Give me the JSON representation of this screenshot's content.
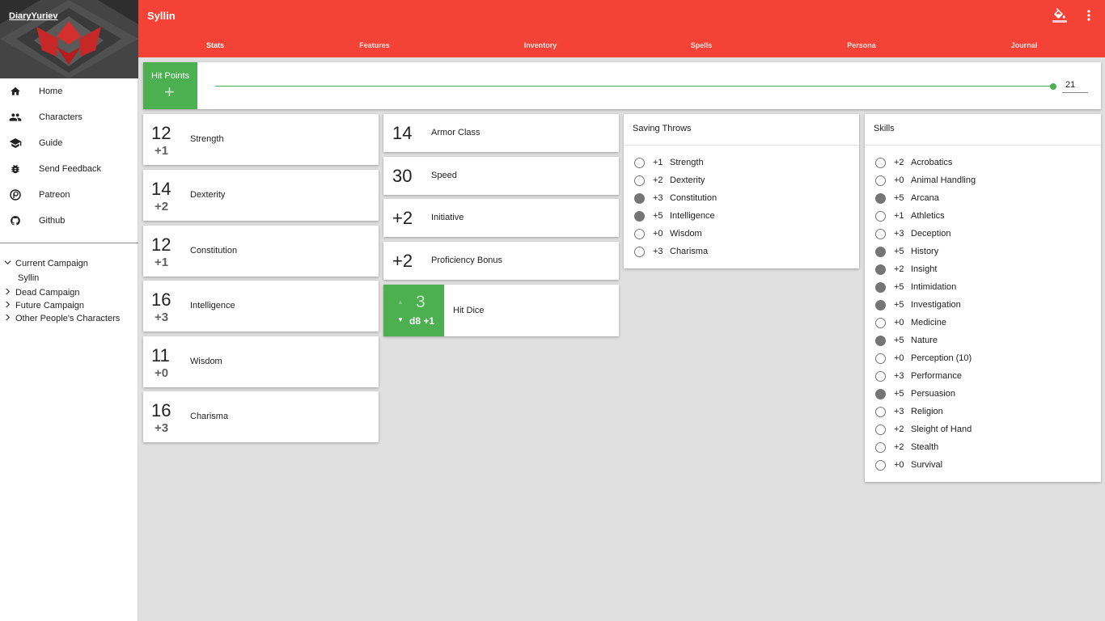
{
  "sidebar": {
    "user": "DiaryYuriev",
    "nav": [
      {
        "label": "Home",
        "icon": "home-icon"
      },
      {
        "label": "Characters",
        "icon": "people-icon"
      },
      {
        "label": "Guide",
        "icon": "school-icon"
      },
      {
        "label": "Send Feedback",
        "icon": "bug-icon"
      },
      {
        "label": "Patreon",
        "icon": "patreon-icon"
      },
      {
        "label": "Github",
        "icon": "github-icon"
      }
    ],
    "campaigns": [
      {
        "label": "Current Campaign",
        "expanded": true,
        "children": [
          "Syllin"
        ]
      },
      {
        "label": "Dead Campaign",
        "expanded": false
      },
      {
        "label": "Future Campaign",
        "expanded": false
      },
      {
        "label": "Other People's Characters",
        "expanded": false
      }
    ]
  },
  "header": {
    "title": "Syllin",
    "tabs": [
      "Stats",
      "Features",
      "Inventory",
      "Spells",
      "Persona",
      "Journal"
    ],
    "active_tab": "Stats"
  },
  "hit_points": {
    "label": "Hit Points",
    "plus": "+",
    "value": "21"
  },
  "abilities": [
    {
      "score": "12",
      "mod": "+1",
      "name": "Strength"
    },
    {
      "score": "14",
      "mod": "+2",
      "name": "Dexterity"
    },
    {
      "score": "12",
      "mod": "+1",
      "name": "Constitution"
    },
    {
      "score": "16",
      "mod": "+3",
      "name": "Intelligence"
    },
    {
      "score": "11",
      "mod": "+0",
      "name": "Wisdom"
    },
    {
      "score": "16",
      "mod": "+3",
      "name": "Charisma"
    }
  ],
  "stats": [
    {
      "value": "14",
      "name": "Armor Class"
    },
    {
      "value": "30",
      "name": "Speed"
    },
    {
      "value": "+2",
      "name": "Initiative"
    },
    {
      "value": "+2",
      "name": "Proficiency Bonus"
    }
  ],
  "hit_dice": {
    "count": "3",
    "die": "d8 +1",
    "label": "Hit Dice",
    "up": "▲",
    "down": "▼"
  },
  "saving_throws": {
    "title": "Saving Throws",
    "items": [
      {
        "mod": "+1",
        "name": "Strength",
        "proficient": false
      },
      {
        "mod": "+2",
        "name": "Dexterity",
        "proficient": false
      },
      {
        "mod": "+3",
        "name": "Constitution",
        "proficient": true
      },
      {
        "mod": "+5",
        "name": "Intelligence",
        "proficient": true
      },
      {
        "mod": "+0",
        "name": "Wisdom",
        "proficient": false
      },
      {
        "mod": "+3",
        "name": "Charisma",
        "proficient": false
      }
    ]
  },
  "skills": {
    "title": "Skills",
    "items": [
      {
        "mod": "+2",
        "name": "Acrobatics",
        "proficient": false
      },
      {
        "mod": "+0",
        "name": "Animal Handling",
        "proficient": false
      },
      {
        "mod": "+5",
        "name": "Arcana",
        "proficient": true
      },
      {
        "mod": "+1",
        "name": "Athletics",
        "proficient": false
      },
      {
        "mod": "+3",
        "name": "Deception",
        "proficient": false
      },
      {
        "mod": "+5",
        "name": "History",
        "proficient": true
      },
      {
        "mod": "+2",
        "name": "Insight",
        "proficient": true
      },
      {
        "mod": "+5",
        "name": "Intimidation",
        "proficient": true
      },
      {
        "mod": "+5",
        "name": "Investigation",
        "proficient": true
      },
      {
        "mod": "+0",
        "name": "Medicine",
        "proficient": false
      },
      {
        "mod": "+5",
        "name": "Nature",
        "proficient": true
      },
      {
        "mod": "+0",
        "name": "Perception (10)",
        "proficient": false
      },
      {
        "mod": "+3",
        "name": "Performance",
        "proficient": false
      },
      {
        "mod": "+5",
        "name": "Persuasion",
        "proficient": true
      },
      {
        "mod": "+3",
        "name": "Religion",
        "proficient": false
      },
      {
        "mod": "+2",
        "name": "Sleight of Hand",
        "proficient": false
      },
      {
        "mod": "+2",
        "name": "Stealth",
        "proficient": false
      },
      {
        "mod": "+0",
        "name": "Survival",
        "proficient": false
      }
    ]
  },
  "colors": {
    "primary": "#f44336",
    "accent": "#4caf50",
    "background": "#e0e0e0",
    "proficient_dot": "#757575"
  },
  "icons": {
    "paint": "format-color-fill-icon",
    "more": "more-vert-icon"
  }
}
